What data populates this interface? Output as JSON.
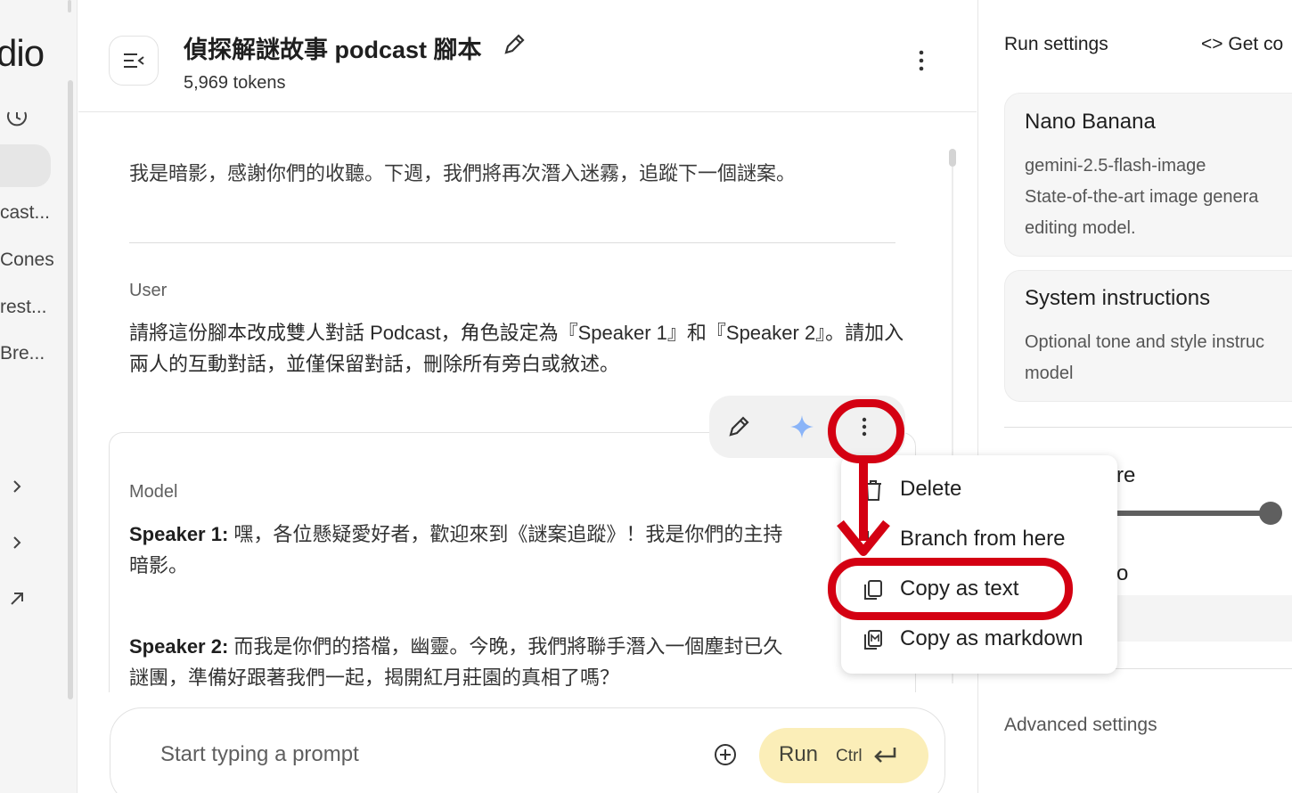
{
  "sidebar": {
    "brand": "dio",
    "recent_items": [
      "cast...",
      "Cones",
      "rest...",
      "Bre..."
    ]
  },
  "header": {
    "title": "偵探解謎故事 podcast 腳本",
    "tokens": "5,969 tokens"
  },
  "chat": {
    "previous_model_tail": "我是暗影，感謝你們的收聽。下週，我們將再次潛入迷霧，追蹤下一個謎案。",
    "user_label": "User",
    "user_text": "請將這份腳本改成雙人對話 Podcast，角色設定為『Speaker 1』和『Speaker 2』。請加入兩人的互動對話，並僅保留對話，刪除所有旁白或敘述。",
    "model_label": "Model",
    "lines": [
      {
        "speaker": "Speaker 1:",
        "text": " 嘿，各位懸疑愛好者，歡迎來到《謎案追蹤》！我是你們的主持",
        "cont": "暗影。"
      },
      {
        "speaker": "Speaker 2:",
        "text": " 而我是你們的搭檔，幽靈。今晚，我們將聯手潛入一個塵封已久",
        "cont": "謎團，準備好跟著我們一起，揭開紅月莊園的真相了嗎？"
      }
    ]
  },
  "context_menu": {
    "items": [
      {
        "label": "Delete",
        "icon": "trash-icon"
      },
      {
        "label": "Branch from here",
        "icon": "branch-icon"
      },
      {
        "label": "Copy as text",
        "icon": "copy-icon"
      },
      {
        "label": "Copy as markdown",
        "icon": "copy-markdown-icon"
      }
    ]
  },
  "prompt": {
    "placeholder": "Start typing a prompt",
    "run_label": "Run",
    "run_shortcut": "Ctrl"
  },
  "run_settings": {
    "title": "Run settings",
    "get_code": "Get co",
    "model_card": {
      "name": "Nano Banana",
      "id": "gemini-2.5-flash-image",
      "desc_line1": "State-of-the-art image genera",
      "desc_line2": "editing model."
    },
    "system_card": {
      "title": "System instructions",
      "line1": "Optional tone and style instruc",
      "line2": "model"
    },
    "temperature_frag": "re",
    "temperature_value": 1.0,
    "aspect_frag": "o",
    "advanced": "Advanced settings"
  },
  "colors": {
    "accent_red": "#d40012",
    "run_button_bg": "#fbeeb8",
    "sparkle_blue": "#8ab4f8"
  }
}
